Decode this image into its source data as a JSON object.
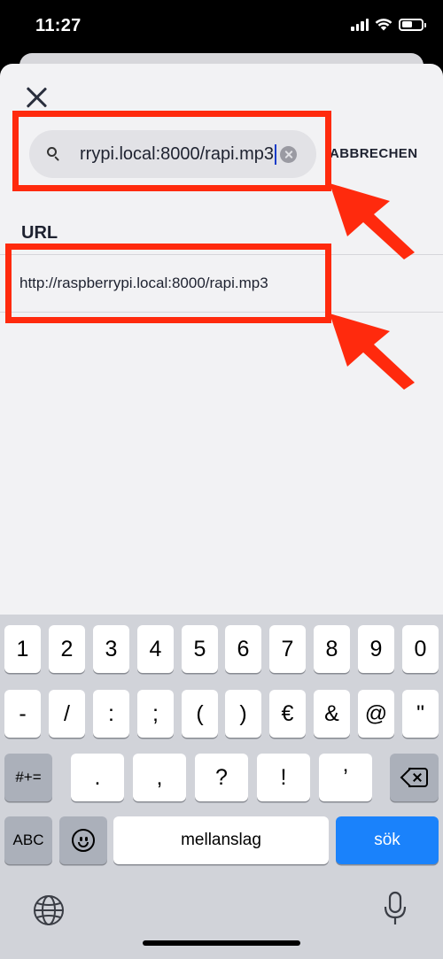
{
  "status_bar": {
    "time": "11:27"
  },
  "header": {
    "close_label": "",
    "cancel_label": "ABBRECHEN"
  },
  "search": {
    "value": "rrypi.local:8000/rapi.mp3"
  },
  "results": {
    "section_title": "URL",
    "items": [
      {
        "label": "http://raspberrypi.local:8000/rapi.mp3"
      }
    ]
  },
  "annotation_color": "#ff2a0d",
  "keyboard": {
    "row1": [
      "1",
      "2",
      "3",
      "4",
      "5",
      "6",
      "7",
      "8",
      "9",
      "0"
    ],
    "row2": [
      "-",
      "/",
      ":",
      ";",
      "(",
      ")",
      "€",
      "&",
      "@",
      "\""
    ],
    "row3_mode": "#+=",
    "row3": [
      ".",
      ",",
      "?",
      "!",
      "’"
    ],
    "abc_label": "ABC",
    "space_label": "mellanslag",
    "return_label": "sök",
    "accent_color": "#1a82fb"
  },
  "icons": {
    "search": "search-icon",
    "clear": "clear-icon",
    "close": "close-icon",
    "backspace": "backspace-icon",
    "emoji": "emoji-icon",
    "globe": "globe-icon",
    "mic": "microphone-icon"
  }
}
